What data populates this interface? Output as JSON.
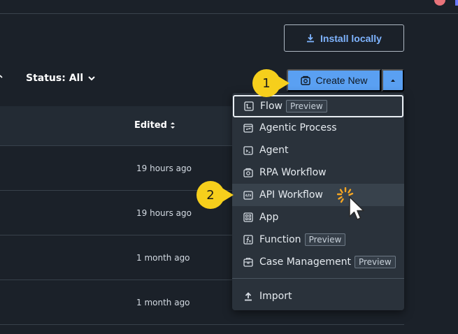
{
  "toolbar": {
    "install_label": "Install locally",
    "status_filter": "Status: All",
    "create_label": "Create New"
  },
  "callouts": [
    "1",
    "2"
  ],
  "table": {
    "edited_header": "Edited",
    "rows": [
      {
        "edited": "19 hours ago"
      },
      {
        "edited": "19 hours ago"
      },
      {
        "edited": "1 month ago"
      },
      {
        "edited": "1 month ago"
      }
    ]
  },
  "menu": {
    "items": [
      {
        "label": "Flow",
        "badge": "Preview",
        "icon": "flow-icon"
      },
      {
        "label": "Agentic Process",
        "badge": "",
        "icon": "agentic-process-icon"
      },
      {
        "label": "Agent",
        "badge": "",
        "icon": "agent-icon"
      },
      {
        "label": "RPA Workflow",
        "badge": "",
        "icon": "rpa-workflow-icon"
      },
      {
        "label": "API Workflow",
        "badge": "",
        "icon": "api-workflow-icon"
      },
      {
        "label": "App",
        "badge": "",
        "icon": "app-icon"
      },
      {
        "label": "Function",
        "badge": "Preview",
        "icon": "function-icon"
      },
      {
        "label": "Case Management",
        "badge": "Preview",
        "icon": "case-management-icon"
      }
    ],
    "import_label": "Import"
  },
  "colors": {
    "accent": "#5aa0f2",
    "callout": "#f6cf1c",
    "background": "#1b2129",
    "menu_bg": "#2a323b"
  }
}
